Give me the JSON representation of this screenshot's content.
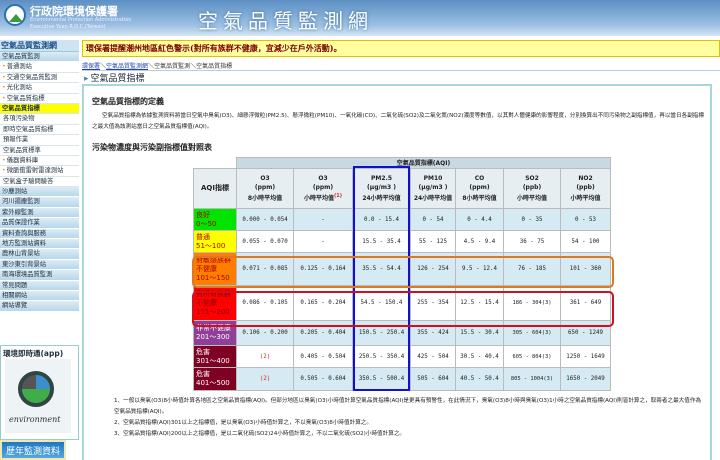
{
  "header": {
    "org_name": "行政院環境保護署",
    "org_en_1": "Environmental Protection Administration",
    "org_en_2": "Executive Yuan R.O.C.(Taiwan)",
    "site_title": "空氣品質監測網"
  },
  "alert": "環保署提醒潮州地區紅色警示(對所有族群不健康，宜減少在戶外活動)。",
  "breadcrumb": [
    "環保署",
    "空氣品質監測網",
    "空氣品質監測",
    "空氣品質指標"
  ],
  "page_title": "空氣品質指標",
  "sidebar": {
    "title": "空氣品質監測網",
    "items": [
      {
        "label": "空氣品質監測",
        "type": "cat"
      },
      {
        "label": "普通測站",
        "type": "dot"
      },
      {
        "label": "交通空氣品質監測",
        "type": "dot"
      },
      {
        "label": "光化測站",
        "type": "dot"
      },
      {
        "label": "空氣品質指標",
        "type": "dot"
      },
      {
        "label": "空氣品質指標",
        "type": "active"
      },
      {
        "label": "各項污染物",
        "type": "sub"
      },
      {
        "label": "即時空氣品質指標",
        "type": "sub"
      },
      {
        "label": "預報作業",
        "type": "sub"
      },
      {
        "label": "空氣品質標準",
        "type": "sub"
      },
      {
        "label": "儀器資料庫",
        "type": "dot"
      },
      {
        "label": "微脈衝雷射雷達測站",
        "type": "dot"
      },
      {
        "label": "空氣盒子驗問驗答",
        "type": "sub"
      },
      {
        "label": "沙塵測站",
        "type": "cat"
      },
      {
        "label": "河川揚塵監測",
        "type": "cat"
      },
      {
        "label": "紫外線監測",
        "type": "cat"
      },
      {
        "label": "品質保證作業",
        "type": "cat"
      },
      {
        "label": "資料查詢與服務",
        "type": "cat"
      },
      {
        "label": "地方監測站資料",
        "type": "cat"
      },
      {
        "label": "鹿林山背景站",
        "type": "cat"
      },
      {
        "label": "東沙東引背景站",
        "type": "cat"
      },
      {
        "label": "南海環境品質監測",
        "type": "cat"
      },
      {
        "label": "常見問題",
        "type": "cat"
      },
      {
        "label": "相關網站",
        "type": "cat"
      },
      {
        "label": "網站導覽",
        "type": "cat"
      }
    ]
  },
  "app": {
    "title": "環境即時通(app)",
    "logo_text": "environment"
  },
  "history_button": "歷年監測資料",
  "definition": {
    "title": "空氣品質指標的定義",
    "text": "空氣品質指標為依據監測資料將當日空氣中臭氧(O3)、細懸浮微粒(PM2.5)、懸浮微粒(PM10)、一氧化碳(CO)、二氧化硫(SO2)及二氧化氮(NO2)濃度等數值，以其對人體健康的影響程度，分別換算出不同污染物之副指標值，再以當日各副指標之最大值為該測站當日之空氣品質指標值(AQI)。"
  },
  "table": {
    "title": "污染物濃度與污染副指標值對照表",
    "group_header": "空氣品質指標(AQI)",
    "aqi_header": "AQI指標",
    "columns": [
      {
        "name": "O3",
        "unit": "(ppm)",
        "avg": "8小時平均值",
        "note": ""
      },
      {
        "name": "O3",
        "unit": "(ppm)",
        "avg": "小時平均值",
        "note": "(1)"
      },
      {
        "name": "PM2.5",
        "unit": "(μg/m3 )",
        "avg": "24小時平均值",
        "note": ""
      },
      {
        "name": "PM10",
        "unit": "(μg/m3 )",
        "avg": "24小時平均值",
        "note": ""
      },
      {
        "name": "CO",
        "unit": "(ppm)",
        "avg": "8小時平均值",
        "note": ""
      },
      {
        "name": "SO2",
        "unit": "(ppb)",
        "avg": "小時平均值",
        "note": ""
      },
      {
        "name": "NO2",
        "unit": "(ppb)",
        "avg": "小時平均值",
        "note": ""
      }
    ],
    "rows": [
      {
        "level": "良好",
        "range": "0～50",
        "color": "#00e400",
        "text": "#a00",
        "cells": [
          "0.000 - 0.054",
          "-",
          "0.0 - 15.4",
          "0 - 54",
          "0 - 4.4",
          "0 - 35",
          "0 - 53"
        ]
      },
      {
        "level": "普通",
        "range": "51～100",
        "color": "#ffff00",
        "text": "#a00",
        "cells": [
          "0.055 - 0.070",
          "-",
          "15.5 - 35.4",
          "55 - 125",
          "4.5 - 9.4",
          "36 - 75",
          "54 - 100"
        ]
      },
      {
        "level": "對敏感族群不健康",
        "range": "101～150",
        "color": "#ff7e00",
        "text": "#a00",
        "cells": [
          "0.071 - 0.085",
          "0.125 - 0.164",
          "35.5 - 54.4",
          "126 - 254",
          "9.5 - 12.4",
          "76 - 185",
          "101 - 360"
        ]
      },
      {
        "level": "對所有族群不健康",
        "range": "151～200",
        "color": "#ff0000",
        "text": "#800",
        "cells": [
          "0.086 - 0.105",
          "0.165 - 0.204",
          "54.5 - 150.4",
          "255 - 354",
          "12.5 - 15.4",
          "186 - 304(3)",
          "361 - 649"
        ]
      },
      {
        "level": "非常不健康",
        "range": "201～300",
        "color": "#8f3f97",
        "text": "#fff",
        "cells": [
          "0.106 - 0.200",
          "0.205 - 0.404",
          "150.5 - 250.4",
          "355 - 424",
          "15.5 - 30.4",
          "305 - 604(3)",
          "650 - 1249"
        ]
      },
      {
        "level": "危害",
        "range": "301～400",
        "color": "#7e0023",
        "text": "#fff",
        "cells": [
          "(2)",
          "0.405 - 0.504",
          "250.5 - 350.4",
          "425 - 504",
          "30.5 - 40.4",
          "605 - 804(3)",
          "1250 - 1649"
        ]
      },
      {
        "level": "危害",
        "range": "401～500",
        "color": "#7e0023",
        "text": "#fff",
        "cells": [
          "(2)",
          "0.505 - 0.604",
          "350.5 - 500.4",
          "505 - 604",
          "40.5 - 50.4",
          "805 - 1004(3)",
          "1650 - 2049"
        ]
      }
    ]
  },
  "notes": [
    "1、一般以臭氧(O3)8小時值計算各地區之空氣品質指標(AQI)。但部分地區以臭氧(O3)小時值計算空氣品質指標(AQI)是更具有預警性，在此情況下，臭氧(O3)8小時與臭氧(O3)1小時之空氣品質指標(AQI)則皆計算之，取兩者之最大值作為空氣品質指標(AQI)。",
    "2、空氣品質指標(AQI)301以上之指標值，是以臭氧(O3)小時值計算之，不以臭氧(O3)8小時值計算之。",
    "3、空氣品質指標(AQI)200以上之指標值，是以二氧化硫(SO2)24小時值計算之，不以二氧化硫(SO2)小時值計算之。"
  ]
}
